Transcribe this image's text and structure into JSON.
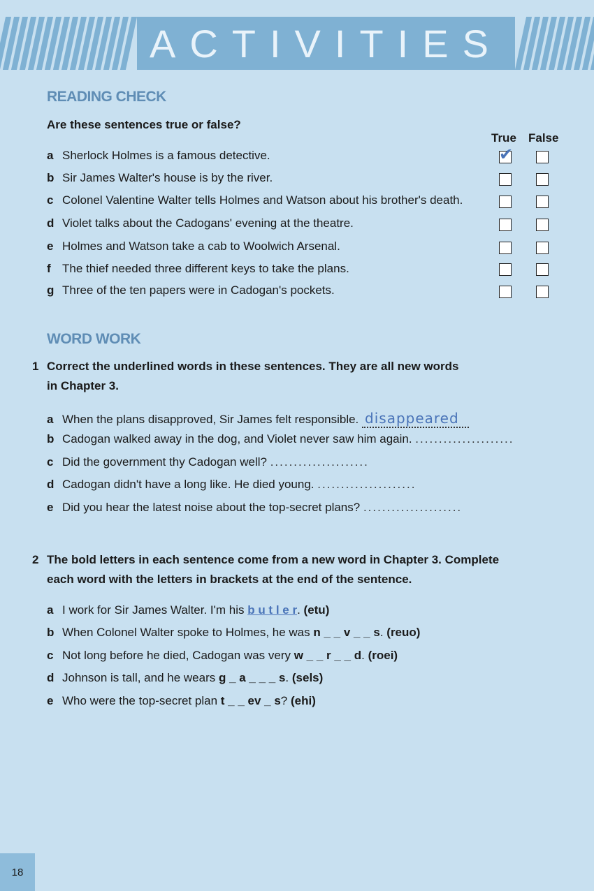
{
  "banner": {
    "title": "ACTIVITIES"
  },
  "reading_check": {
    "title": "READING CHECK",
    "instruction": "Are these sentences true or false?",
    "true_label": "True",
    "false_label": "False",
    "items": [
      {
        "letter": "a",
        "text": "Sherlock Holmes is a famous detective.",
        "answer": "true"
      },
      {
        "letter": "b",
        "text": "Sir James Walter's house is by the river.",
        "answer": ""
      },
      {
        "letter": "c",
        "text": "Colonel Valentine Walter tells Holmes and Watson about his brother's death.",
        "answer": ""
      },
      {
        "letter": "d",
        "text": "Violet talks about the Cadogans' evening at the theatre.",
        "answer": ""
      },
      {
        "letter": "e",
        "text": "Holmes and Watson take a cab to Woolwich Arsenal.",
        "answer": ""
      },
      {
        "letter": "f",
        "text": "The thief needed three different keys to take the plans.",
        "answer": ""
      },
      {
        "letter": "g",
        "text": "Three of the ten papers were in Cadogan's pockets.",
        "answer": ""
      }
    ],
    "check_glyph": "✔"
  },
  "word_work": {
    "title": "WORD WORK",
    "q1": {
      "number": "1",
      "line1": "Correct the underlined words in these sentences. They are all new words",
      "line2": "in Chapter 3.",
      "items": [
        {
          "letter": "a",
          "text": "When the plans disapproved, Sir James felt responsible.",
          "answer": "disappeared"
        },
        {
          "letter": "b",
          "text": "Cadogan walked away in the dog, and Violet never saw him again.",
          "answer": ""
        },
        {
          "letter": "c",
          "text": "Did the government thy Cadogan well?",
          "answer": ""
        },
        {
          "letter": "d",
          "text": "Cadogan didn't have a long like. He died young.",
          "answer": ""
        },
        {
          "letter": "e",
          "text": "Did you hear the latest noise about the top-secret plans?",
          "answer": ""
        }
      ]
    },
    "q2": {
      "number": "2",
      "line1": "The bold letters in each sentence come from a new word in Chapter 3. Complete",
      "line2": "each word with the letters in brackets at the end of the sentence.",
      "items": [
        {
          "letter": "a",
          "before": "I work for Sir James Walter. I'm his ",
          "word": "b u t l e r",
          "after": ".",
          "brackets": "(etu)"
        },
        {
          "letter": "b",
          "before": "When Colonel Walter spoke to Holmes, he was ",
          "word": "n _ _ v _ _ s",
          "after": ".",
          "brackets": "(reuo)"
        },
        {
          "letter": "c",
          "before": "Not long before he died, Cadogan was very ",
          "word": "w _ _ r _ _ d",
          "after": ".",
          "brackets": "(roei)"
        },
        {
          "letter": "d",
          "before": "Johnson is tall, and he wears ",
          "word": "g _ a _ _ _ s",
          "after": ".",
          "brackets": "(sels)"
        },
        {
          "letter": "e",
          "before": "Who were the top-secret plan ",
          "word": "t _ _ ev _ s",
          "after": "?",
          "brackets": "(ehi)"
        }
      ]
    }
  },
  "page_number": "18"
}
